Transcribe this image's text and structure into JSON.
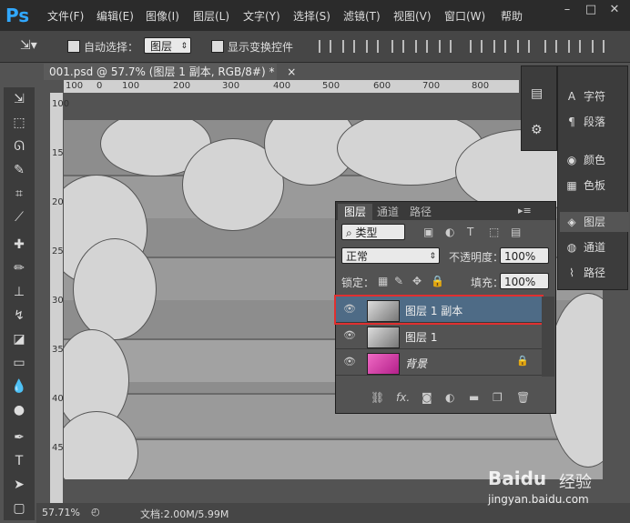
{
  "app": {
    "logo": "Ps"
  },
  "menu": [
    "文件(F)",
    "编辑(E)",
    "图像(I)",
    "图层(L)",
    "文字(Y)",
    "选择(S)",
    "滤镜(T)",
    "视图(V)",
    "窗口(W)",
    "帮助"
  ],
  "window_controls": [
    "–",
    "□",
    "✕"
  ],
  "options": {
    "auto_select_label": "自动选择：",
    "auto_select_value": "图层",
    "transform_label": "显示变换控件"
  },
  "document": {
    "tab_title": "001.psd @ 57.7% (图层 1 副本, RGB/8#) *",
    "close": "×",
    "ruler_h": [
      "100",
      "0",
      "100",
      "200",
      "300",
      "400",
      "500",
      "600",
      "700",
      "800",
      "900"
    ],
    "ruler_v": [
      "100",
      "150",
      "200",
      "250",
      "300",
      "350",
      "400",
      "450",
      "500"
    ]
  },
  "right_panels": {
    "items": [
      {
        "icon": "A",
        "label": "字符"
      },
      {
        "icon": "¶",
        "label": "段落"
      },
      {
        "icon": "◉",
        "label": "颜色"
      },
      {
        "icon": "▦",
        "label": "色板"
      },
      {
        "icon": "◈",
        "label": "图层"
      },
      {
        "icon": "◍",
        "label": "通道"
      },
      {
        "icon": "⌇",
        "label": "路径"
      }
    ]
  },
  "layers_panel": {
    "tabs": [
      "图层",
      "通道",
      "路径"
    ],
    "filter_label": "类型",
    "blend_mode": "正常",
    "opacity_label": "不透明度：",
    "opacity_value": "100%",
    "lock_label": "锁定：",
    "fill_label": "填充：",
    "fill_value": "100%",
    "layers": [
      {
        "name": "图层 1 副本",
        "selected": true
      },
      {
        "name": "图层 1",
        "selected": false
      },
      {
        "name": "背景",
        "selected": false,
        "locked": true
      }
    ]
  },
  "status": {
    "zoom": "57.71%",
    "doc_size": "文档:2.00M/5.99M"
  },
  "watermark": {
    "brand": "Baidu",
    "product": "经验",
    "url": "jingyan.baidu.com"
  },
  "colors": {
    "accent": "#31a8ff",
    "selection_outline": "#e03030",
    "selected_row": "#4e6b86"
  }
}
